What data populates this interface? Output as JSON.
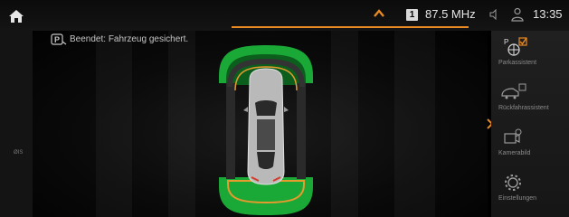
{
  "status_bar": {
    "preset_number": "1",
    "frequency": "87.5 MHz",
    "time": "13:35",
    "icons": [
      "home-icon",
      "chevron-up-icon",
      "volume-icon",
      "user-icon"
    ]
  },
  "left_strip": {
    "label": "ØIS"
  },
  "main": {
    "parking_message": "Beendet: Fahrzeug gesichert.",
    "message_icon": "parking-p-icon",
    "sensor_colors": {
      "far": "#1aa836",
      "near": "#e79a2d",
      "car_body": "#b9b9b9"
    }
  },
  "right_panel": {
    "items": [
      {
        "label": "Parkassistent",
        "icon": "park-assist-icon",
        "checked": true
      },
      {
        "label": "Rückfahrassistent",
        "icon": "reverse-assist-icon",
        "checked": false
      },
      {
        "label": "Kamerabild",
        "icon": "camera-icon",
        "checked": false
      },
      {
        "label": "Einstellungen",
        "icon": "settings-gear-icon",
        "checked": false
      }
    ]
  },
  "colors": {
    "accent": "#e98a22",
    "check": "#e98a22"
  }
}
